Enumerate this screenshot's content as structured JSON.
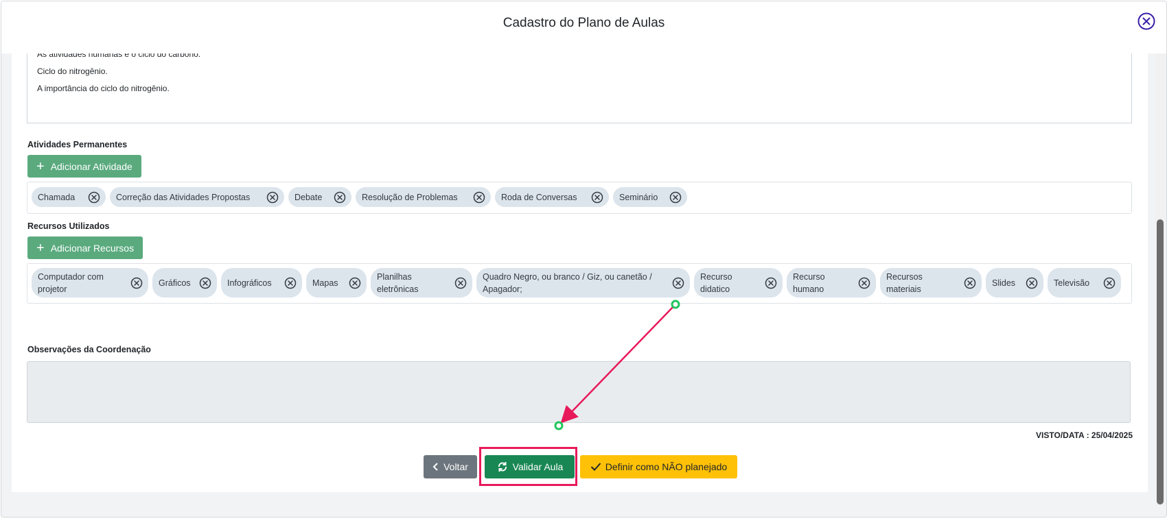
{
  "modal": {
    "title": "Cadastro do Plano de Aulas",
    "close_icon": "close-circle-icon"
  },
  "content_lines": [
    "As atividades humanas e o ciclo do carbono.",
    "Ciclo do nitrogênio.",
    "A importância do ciclo do nitrogênio."
  ],
  "atividades": {
    "label": "Atividades Permanentes",
    "add_button": "Adicionar Atividade",
    "chips": [
      "Chamada",
      "Correção das Atividades Propostas",
      "Debate",
      "Resolução de Problemas",
      "Roda de Conversas",
      "Seminário"
    ]
  },
  "recursos": {
    "label": "Recursos Utilizados",
    "add_button": "Adicionar Recursos",
    "chips": [
      "Computador com projetor",
      "Gráficos",
      "Infográficos",
      "Mapas",
      "Planilhas eletrônicas",
      "Quadro Negro, ou branco / Giz, ou canetão / Apagador;",
      "Recurso didatico",
      "Recurso humano",
      "Recursos materiais",
      "Slides",
      "Televisão"
    ]
  },
  "observacoes": {
    "label": "Observações da Coordenação",
    "value": ""
  },
  "visto": "VISTO/DATA : 25/04/2025",
  "buttons": {
    "voltar": "Voltar",
    "validar": "Validar Aula",
    "nao_planejado": "Definir como NÃO planejado"
  },
  "colors": {
    "add_button": "#5aaa7e",
    "chip": "#dce4ec",
    "validar": "#198754",
    "voltar": "#6c757d",
    "nao_planejado": "#ffc107",
    "annotation": "#e8195a",
    "close_icon": "#3a1fa8"
  }
}
